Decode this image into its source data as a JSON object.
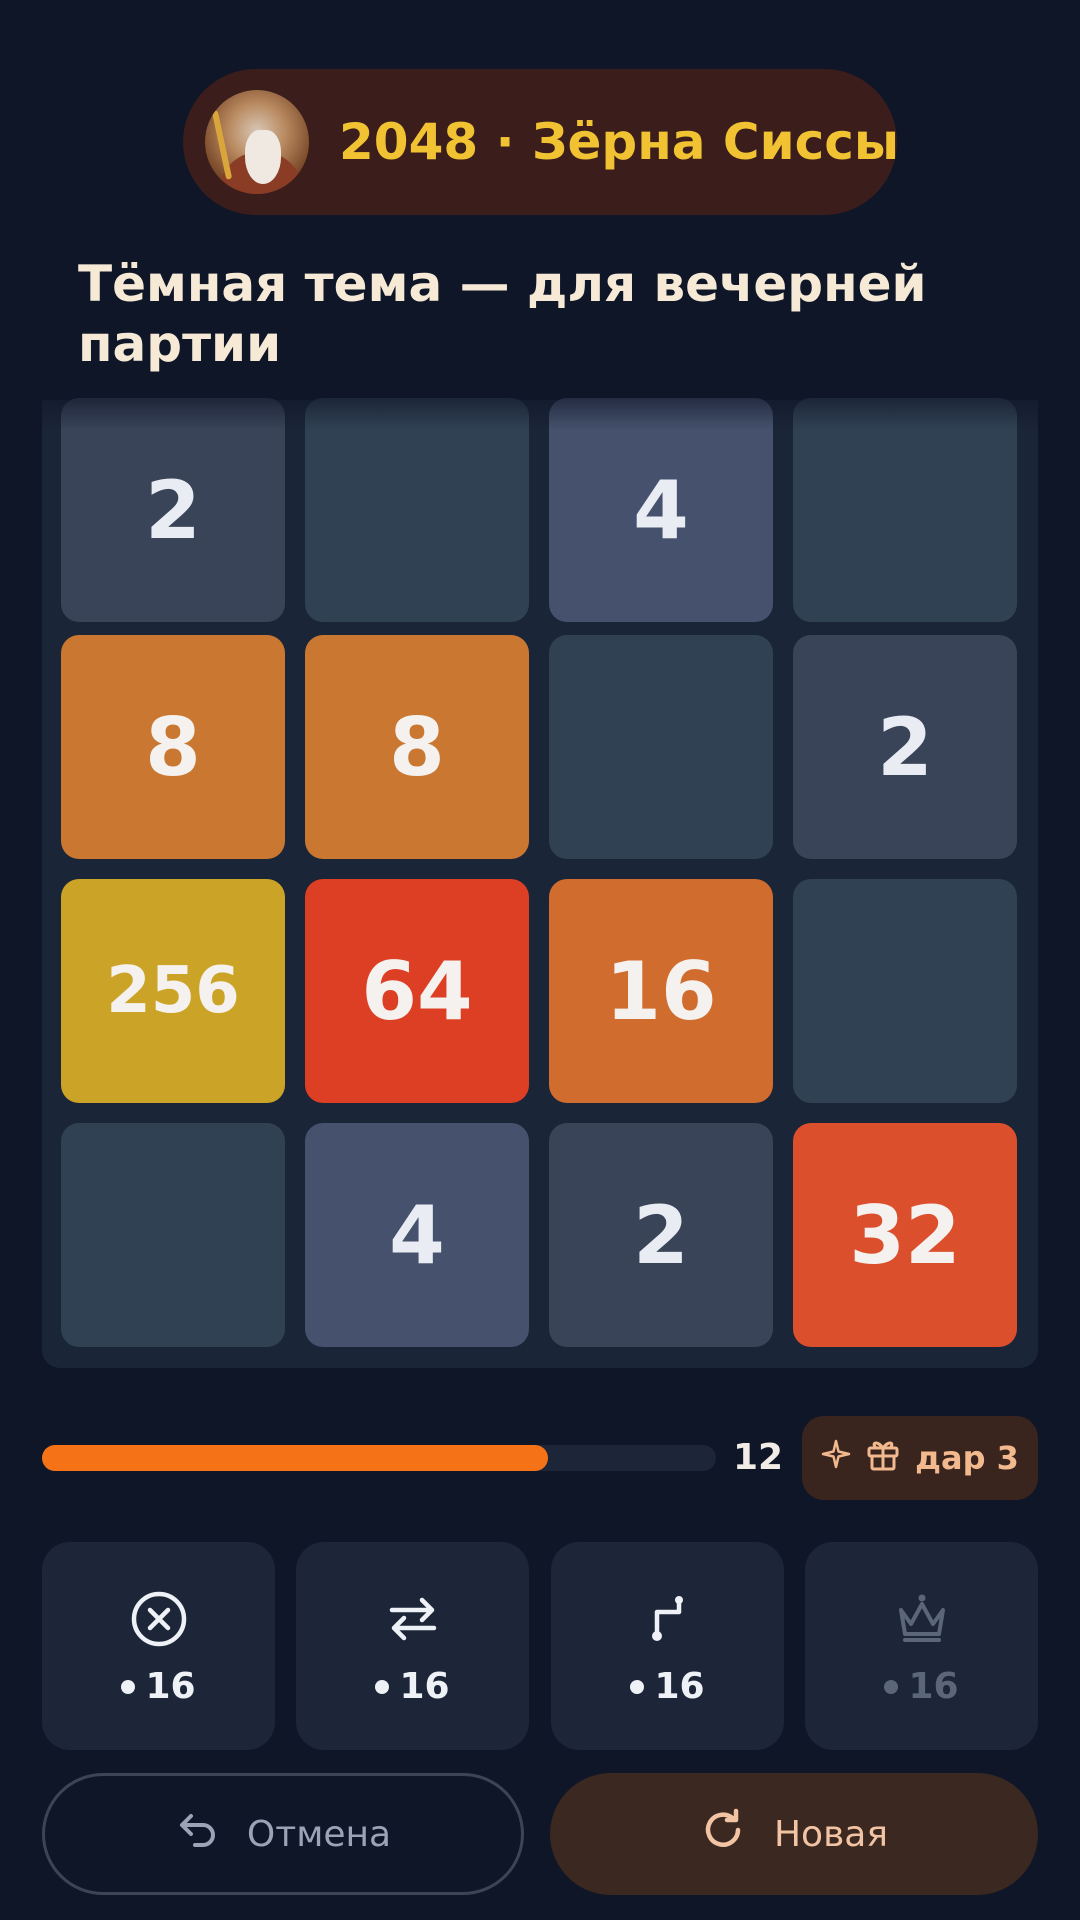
{
  "header": {
    "title": "2048 · Зёрна Сиссы",
    "avatar_alt": "sage-with-wheat"
  },
  "subtitle": "Тёмная тема — для вечерней партии",
  "board": {
    "tiles": [
      [
        2,
        null,
        4,
        null
      ],
      [
        8,
        8,
        null,
        2
      ],
      [
        256,
        64,
        16,
        null
      ],
      [
        null,
        4,
        2,
        32
      ]
    ],
    "colors": {
      "empty": "#314154",
      "2": "#394459",
      "4": "#46526d",
      "8": "#c97731",
      "16": "#d16c2f",
      "32": "#dc4f2c",
      "64": "#dd3f24",
      "256": "#cba427"
    }
  },
  "progress": {
    "fraction": 0.75,
    "count": "12",
    "fill_color": "#f57316"
  },
  "gift": {
    "label": "дар 3",
    "icons": [
      "sparkle-icon",
      "gift-icon"
    ]
  },
  "powerups": [
    {
      "icon": "remove-tile-icon",
      "cost": "16",
      "enabled": true
    },
    {
      "icon": "swap-icon",
      "cost": "16",
      "enabled": true
    },
    {
      "icon": "move-path-icon",
      "cost": "16",
      "enabled": true
    },
    {
      "icon": "crown-icon",
      "cost": "16",
      "enabled": false
    }
  ],
  "actions": {
    "undo_label": "Отмена",
    "new_label": "Новая"
  }
}
